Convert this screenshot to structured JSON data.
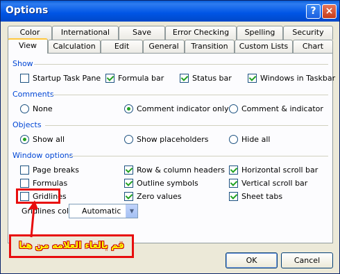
{
  "window": {
    "title": "Options",
    "help_icon": "?",
    "close_icon": "×"
  },
  "tabs": {
    "row1": [
      "Color",
      "International",
      "Save",
      "Error Checking",
      "Spelling",
      "Security"
    ],
    "row2": [
      "View",
      "Calculation",
      "Edit",
      "General",
      "Transition",
      "Custom Lists",
      "Chart"
    ],
    "active": "View"
  },
  "show": {
    "label": "Show",
    "items": [
      {
        "label": "Startup Task Pane",
        "checked": false
      },
      {
        "label": "Formula bar",
        "checked": true
      },
      {
        "label": "Status bar",
        "checked": true
      },
      {
        "label": "Windows in Taskbar",
        "checked": true
      }
    ]
  },
  "comments": {
    "label": "Comments",
    "options": [
      {
        "label": "None",
        "selected": false
      },
      {
        "label": "Comment indicator only",
        "selected": true
      },
      {
        "label": "Comment & indicator",
        "selected": false
      }
    ]
  },
  "objects": {
    "label": "Objects",
    "options": [
      {
        "label": "Show all",
        "selected": true
      },
      {
        "label": "Show placeholders",
        "selected": false
      },
      {
        "label": "Hide all",
        "selected": false
      }
    ]
  },
  "window_options": {
    "label": "Window options",
    "items": [
      {
        "label": "Page breaks",
        "checked": false
      },
      {
        "label": "Formulas",
        "checked": false
      },
      {
        "label": "Gridlines",
        "checked": false
      },
      {
        "label": "Row & column headers",
        "checked": true
      },
      {
        "label": "Outline symbols",
        "checked": true
      },
      {
        "label": "Zero values",
        "checked": true
      },
      {
        "label": "Horizontal scroll bar",
        "checked": true
      },
      {
        "label": "Vertical scroll bar",
        "checked": true
      },
      {
        "label": "Sheet tabs",
        "checked": true
      }
    ],
    "gridlines_color_label": "Gridlines color:",
    "gridlines_color_value": "Automatic"
  },
  "buttons": {
    "ok": "OK",
    "cancel": "Cancel"
  },
  "annotation": {
    "text": "قم بالغاء العلامه من هنا",
    "color": "#e80d0d"
  }
}
